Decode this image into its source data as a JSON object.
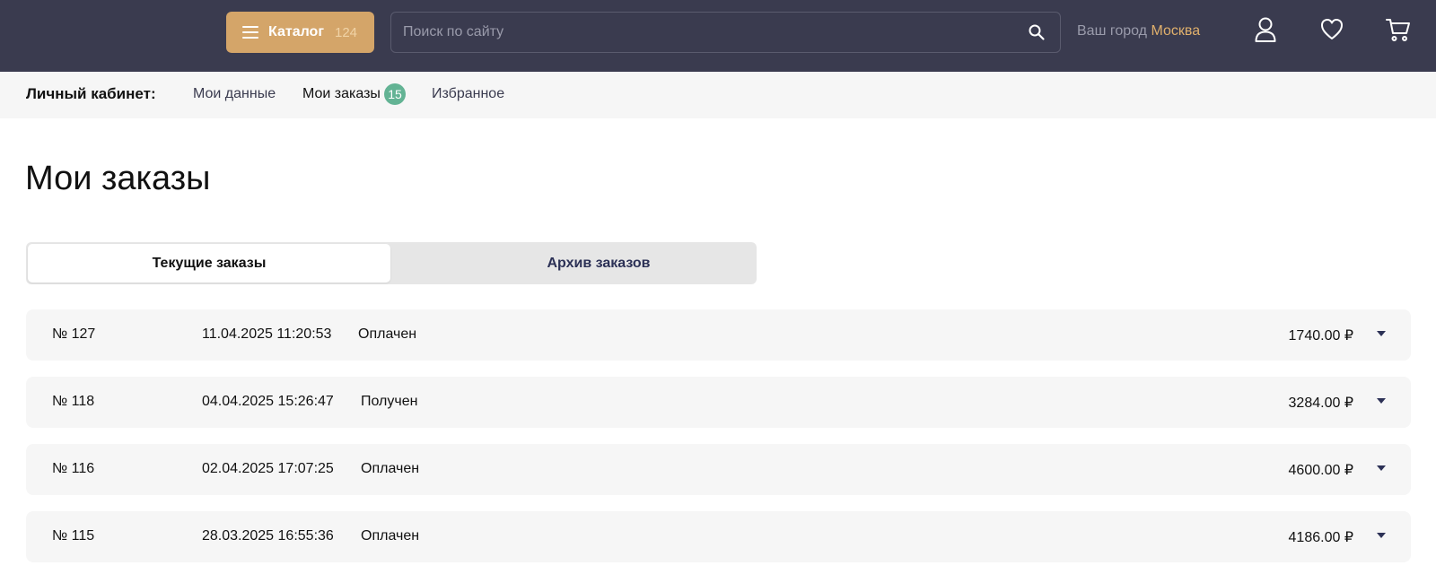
{
  "header": {
    "catalog_label": "Каталог",
    "catalog_count": "124",
    "search_placeholder": "Поиск по сайту",
    "city_label": "Ваш город",
    "city_name": "Москва"
  },
  "account_nav": {
    "title": "Личный кабинет:",
    "items": [
      {
        "label": "Мои данные"
      },
      {
        "label": "Мои заказы",
        "badge": "15"
      },
      {
        "label": "Избранное"
      }
    ]
  },
  "page": {
    "title": "Мои заказы"
  },
  "tabs": [
    {
      "label": "Текущие заказы",
      "active": true
    },
    {
      "label": "Архив заказов",
      "active": false
    }
  ],
  "orders": [
    {
      "number": "№ 127",
      "date": "11.04.2025 11:20:53",
      "status": "Оплачен",
      "total": "1740.00 ₽"
    },
    {
      "number": "№ 118",
      "date": "04.04.2025 15:26:47",
      "status": "Получен",
      "total": "3284.00 ₽"
    },
    {
      "number": "№ 116",
      "date": "02.04.2025 17:07:25",
      "status": "Оплачен",
      "total": "4600.00 ₽"
    },
    {
      "number": "№ 115",
      "date": "28.03.2025 16:55:36",
      "status": "Оплачен",
      "total": "4186.00 ₽"
    }
  ],
  "colors": {
    "header_bg": "#3a3b4f",
    "accent": "#d4a569",
    "badge": "#63b394",
    "row_bg": "#f6f6f6"
  },
  "icons": [
    "menu-icon",
    "search-icon",
    "user-icon",
    "heart-icon",
    "cart-icon",
    "chevron-down-icon"
  ]
}
